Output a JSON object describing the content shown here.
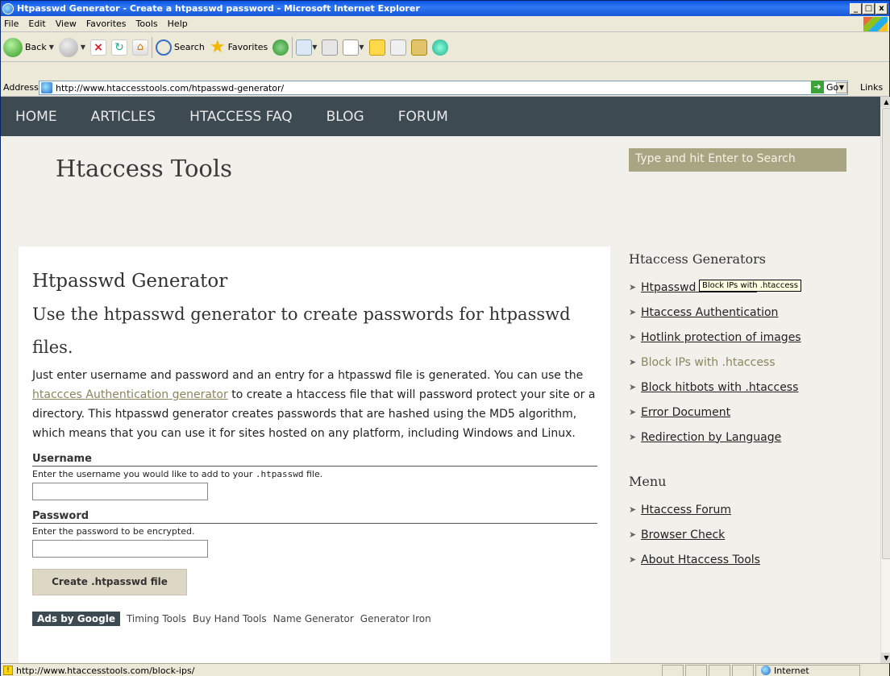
{
  "window": {
    "title": "Htpasswd Generator - Create a htpasswd password - Microsoft Internet Explorer",
    "controls": [
      "_",
      "□",
      "x"
    ]
  },
  "menubar": [
    "File",
    "Edit",
    "View",
    "Favorites",
    "Tools",
    "Help"
  ],
  "toolbar": {
    "back_label": "Back",
    "search_label": "Search",
    "favorites_label": "Favorites"
  },
  "addressbar": {
    "label": "Address",
    "url": "http://www.htaccesstools.com/htpasswd-generator/",
    "go_label": "Go",
    "links_label": "Links"
  },
  "site": {
    "nav": [
      "HOME",
      "ARTICLES",
      "HTACCESS FAQ",
      "BLOG",
      "FORUM"
    ],
    "title": "Htaccess Tools",
    "search_placeholder": "Type and hit Enter to Search"
  },
  "main": {
    "heading": "Htpasswd Generator",
    "subheading": "Use the htpasswd generator to create passwords for htpasswd files.",
    "intro_part1": "Just enter username and password and an entry for a htpasswd file is generated. You can use the ",
    "intro_link": "htaccces Authentication generator",
    "intro_part2": " to create a htaccess file that will password protect your site or a directory. This htpasswd generator creates passwords that are hashed using the MD5 algorithm, which means that you can use it for sites hosted on any platform, including Windows and Linux.",
    "username_label": "Username",
    "username_help_pre": "Enter the username you would like to add to your ",
    "username_help_code": ".htpasswd",
    "username_help_post": " file.",
    "password_label": "Password",
    "password_help": "Enter the password to be encrypted.",
    "submit_label": "Create .htpasswd file",
    "ads_label": "Ads by Google",
    "ads_links": [
      "Timing Tools",
      "Buy Hand Tools",
      "Name Generator",
      "Generator Iron"
    ]
  },
  "sidebar": {
    "generators_heading": "Htaccess Generators",
    "generators": [
      "Htpasswd Generator",
      "Htaccess Authentication",
      "Hotlink protection of images",
      "Block IPs with .htaccess",
      "Block hitbots with .htaccess",
      "Error Document",
      "Redirection by Language"
    ],
    "menu_heading": "Menu",
    "menu": [
      "Htaccess Forum",
      "Browser Check",
      "About Htaccess Tools"
    ]
  },
  "tooltip": "Block IPs with .htaccess",
  "statusbar": {
    "text": "http://www.htaccesstools.com/block-ips/",
    "zone": "Internet"
  }
}
